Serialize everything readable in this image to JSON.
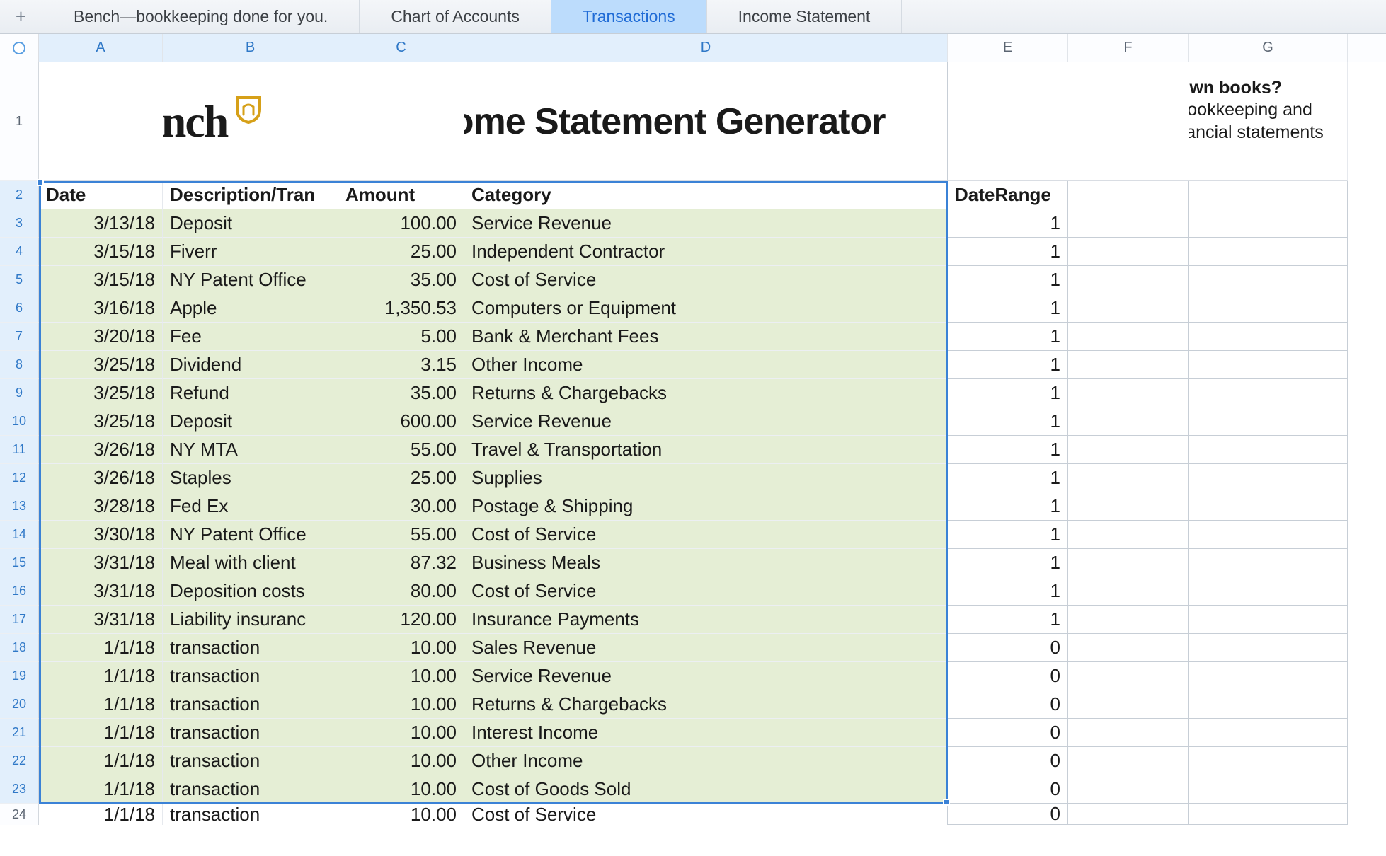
{
  "tabs": {
    "items": [
      {
        "label": "Bench—bookkeeping done for you.",
        "active": false
      },
      {
        "label": "Chart of Accounts",
        "active": false
      },
      {
        "label": "Transactions",
        "active": true
      },
      {
        "label": "Income Statement",
        "active": false
      }
    ]
  },
  "columns": [
    "A",
    "B",
    "C",
    "D",
    "E",
    "F",
    "G"
  ],
  "row1": {
    "logo_text": "Bench",
    "title": "Income Statement Generator",
    "promo_bold": "Tired of doing your own books?",
    "promo_rest": "We'll do a month of your bookkeeping and provide you with a set of financial statements for free."
  },
  "headers": {
    "A": "Date",
    "B": "Description/Tran",
    "C": "Amount",
    "D": "Category",
    "E": "DateRange",
    "F": "",
    "G": ""
  },
  "rows": [
    {
      "n": 3,
      "date": "3/13/18",
      "desc": "Deposit",
      "amount": "100.00",
      "category": "Service Revenue",
      "range": "1",
      "green": true
    },
    {
      "n": 4,
      "date": "3/15/18",
      "desc": "Fiverr",
      "amount": "25.00",
      "category": "Independent Contractor",
      "range": "1",
      "green": true
    },
    {
      "n": 5,
      "date": "3/15/18",
      "desc": "NY Patent Office",
      "amount": "35.00",
      "category": "Cost of Service",
      "range": "1",
      "green": true
    },
    {
      "n": 6,
      "date": "3/16/18",
      "desc": "Apple",
      "amount": "1,350.53",
      "category": "Computers or Equipment",
      "range": "1",
      "green": true
    },
    {
      "n": 7,
      "date": "3/20/18",
      "desc": "Fee",
      "amount": "5.00",
      "category": "Bank & Merchant Fees",
      "range": "1",
      "green": true
    },
    {
      "n": 8,
      "date": "3/25/18",
      "desc": "Dividend",
      "amount": "3.15",
      "category": "Other Income",
      "range": "1",
      "green": true
    },
    {
      "n": 9,
      "date": "3/25/18",
      "desc": "Refund",
      "amount": "35.00",
      "category": "Returns & Chargebacks",
      "range": "1",
      "green": true
    },
    {
      "n": 10,
      "date": "3/25/18",
      "desc": "Deposit",
      "amount": "600.00",
      "category": "Service Revenue",
      "range": "1",
      "green": true
    },
    {
      "n": 11,
      "date": "3/26/18",
      "desc": "NY MTA",
      "amount": "55.00",
      "category": "Travel & Transportation",
      "range": "1",
      "green": true
    },
    {
      "n": 12,
      "date": "3/26/18",
      "desc": "Staples",
      "amount": "25.00",
      "category": "Supplies",
      "range": "1",
      "green": true
    },
    {
      "n": 13,
      "date": "3/28/18",
      "desc": "Fed Ex",
      "amount": "30.00",
      "category": "Postage & Shipping",
      "range": "1",
      "green": true
    },
    {
      "n": 14,
      "date": "3/30/18",
      "desc": "NY Patent Office",
      "amount": "55.00",
      "category": "Cost of Service",
      "range": "1",
      "green": true
    },
    {
      "n": 15,
      "date": "3/31/18",
      "desc": "Meal with client",
      "amount": "87.32",
      "category": "Business Meals",
      "range": "1",
      "green": true
    },
    {
      "n": 16,
      "date": "3/31/18",
      "desc": "Deposition costs",
      "amount": "80.00",
      "category": "Cost of Service",
      "range": "1",
      "green": true
    },
    {
      "n": 17,
      "date": "3/31/18",
      "desc": "Liability insuranc",
      "amount": "120.00",
      "category": "Insurance Payments",
      "range": "1",
      "green": true
    },
    {
      "n": 18,
      "date": "1/1/18",
      "desc": "transaction",
      "amount": "10.00",
      "category": "Sales Revenue",
      "range": "0",
      "green": true
    },
    {
      "n": 19,
      "date": "1/1/18",
      "desc": "transaction",
      "amount": "10.00",
      "category": "Service Revenue",
      "range": "0",
      "green": true
    },
    {
      "n": 20,
      "date": "1/1/18",
      "desc": "transaction",
      "amount": "10.00",
      "category": "Returns & Chargebacks",
      "range": "0",
      "green": true
    },
    {
      "n": 21,
      "date": "1/1/18",
      "desc": "transaction",
      "amount": "10.00",
      "category": "Interest Income",
      "range": "0",
      "green": true
    },
    {
      "n": 22,
      "date": "1/1/18",
      "desc": "transaction",
      "amount": "10.00",
      "category": "Other Income",
      "range": "0",
      "green": true
    },
    {
      "n": 23,
      "date": "1/1/18",
      "desc": "transaction",
      "amount": "10.00",
      "category": "Cost of Goods Sold",
      "range": "0",
      "green": true
    },
    {
      "n": 24,
      "date": "1/1/18",
      "desc": "transaction",
      "amount": "10.00",
      "category": "Cost of Service",
      "range": "0",
      "green": false,
      "partial": true
    }
  ],
  "selection": {
    "note": "A2:D23 roughly — blue rectangle covers header row 2 through row 23, cols A-D"
  }
}
